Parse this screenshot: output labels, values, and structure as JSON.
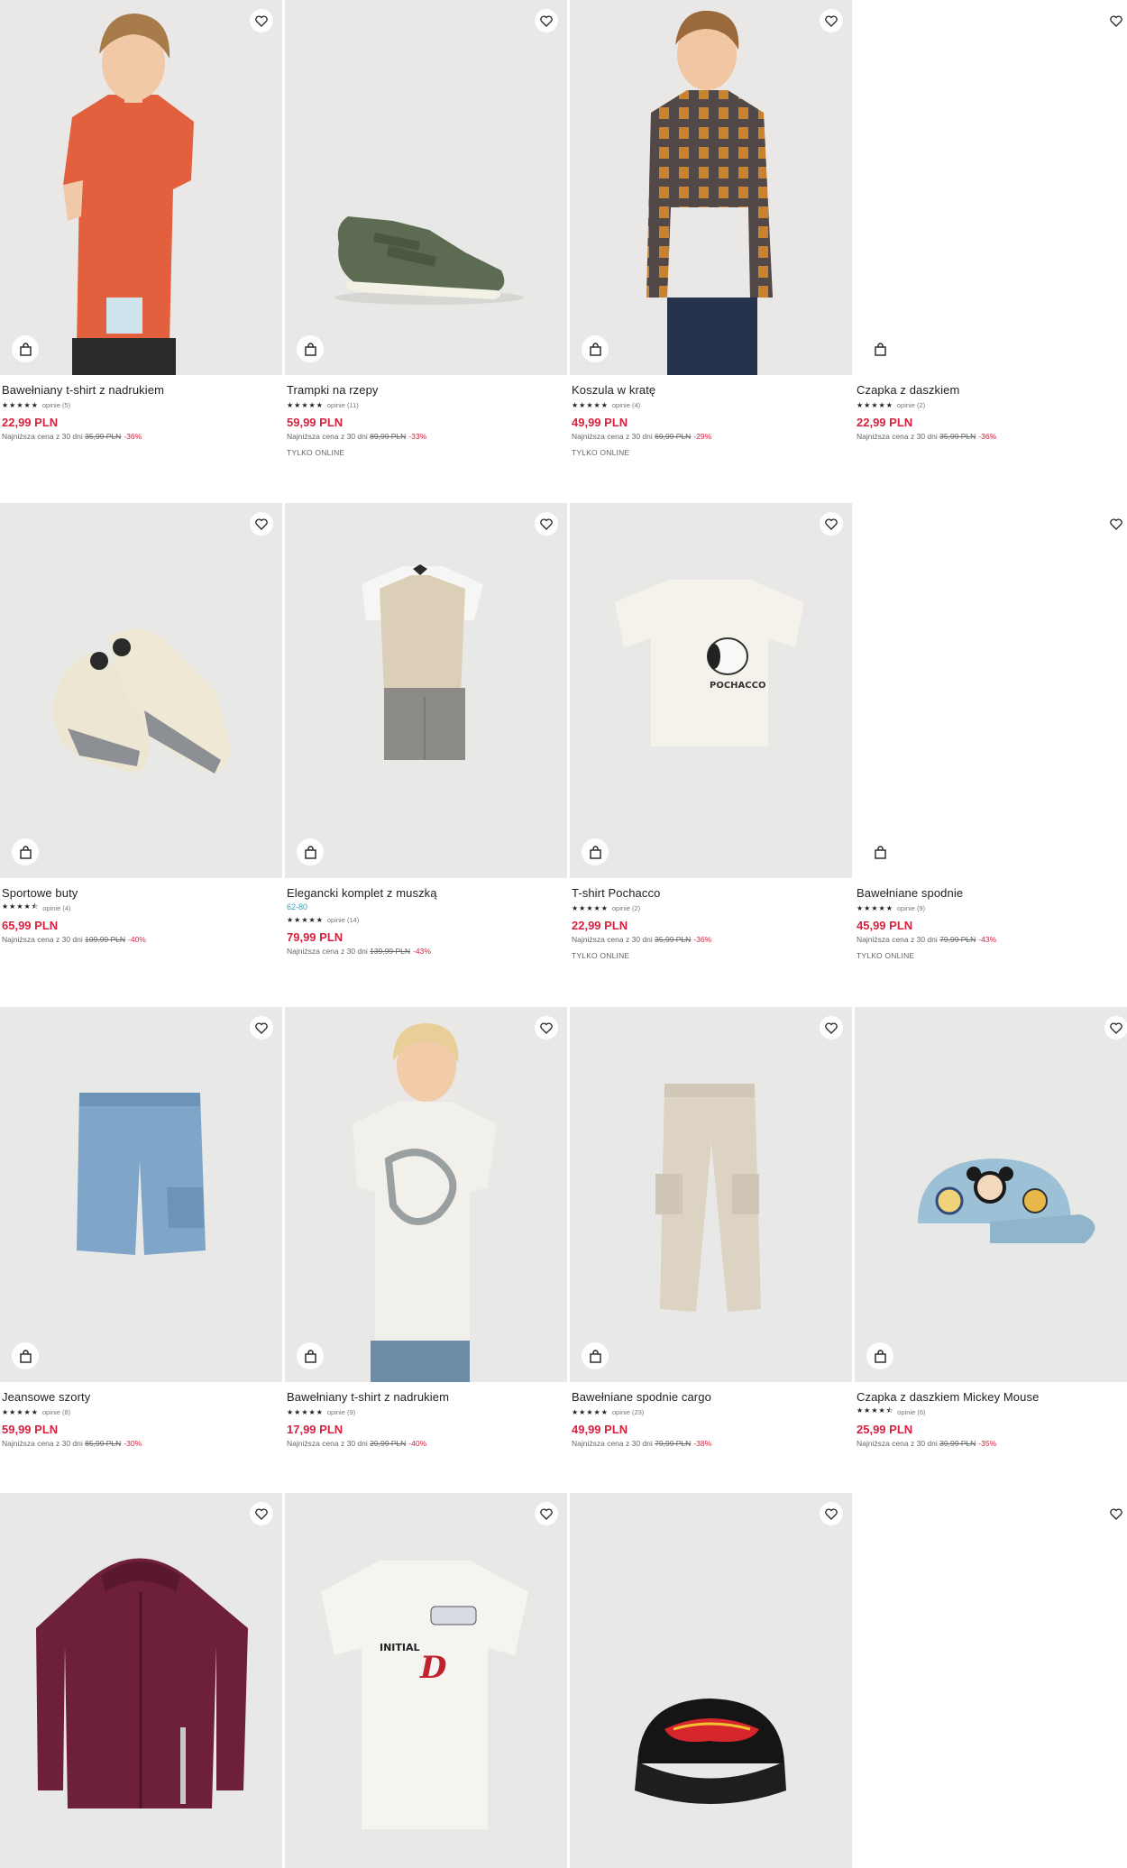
{
  "products": [
    {
      "title": "Bawełniany t-shirt z nadrukiem",
      "size": "",
      "stars": "★★★★★",
      "reviews": "opinie (5)",
      "price": "22,99 PLN",
      "lowest_label": "Najniższa cena z 30 dni",
      "old_price": "35,99 PLN",
      "discount": "-36%",
      "badge": "",
      "image": "boy-orange-tshirt"
    },
    {
      "title": "Trampki na rzepy",
      "size": "",
      "stars": "★★★★★",
      "reviews": "opinie (11)",
      "price": "59,99 PLN",
      "lowest_label": "Najniższa cena z 30 dni",
      "old_price": "89,99 PLN",
      "discount": "-33%",
      "badge": "TYLKO ONLINE",
      "image": "green-velcro-sneaker"
    },
    {
      "title": "Koszula w kratę",
      "size": "",
      "stars": "★★★★★",
      "reviews": "opinie (4)",
      "price": "49,99 PLN",
      "lowest_label": "Najniższa cena z 30 dni",
      "old_price": "69,99 PLN",
      "discount": "-29%",
      "badge": "TYLKO ONLINE",
      "image": "boy-plaid-shirt"
    },
    {
      "title": "Czapka z daszkiem",
      "size": "",
      "stars": "★★★★★",
      "reviews": "opinie (2)",
      "price": "22,99 PLN",
      "lowest_label": "Najniższa cena z 30 dni",
      "old_price": "35,99 PLN",
      "discount": "-36%",
      "badge": "",
      "image": "blank"
    },
    {
      "title": "Sportowe buty",
      "size": "",
      "stars": "★★★★⯪",
      "reviews": "opinie (4)",
      "price": "65,99 PLN",
      "lowest_label": "Najniższa cena z 30 dni",
      "old_price": "109,99 PLN",
      "discount": "-40%",
      "badge": "",
      "image": "sport-sneakers"
    },
    {
      "title": "Elegancki komplet z muszką",
      "size": "62-80",
      "stars": "★★★★★",
      "reviews": "opinie (14)",
      "price": "79,99 PLN",
      "lowest_label": "Najniższa cena z 30 dni",
      "old_price": "139,99 PLN",
      "discount": "-43%",
      "badge": "",
      "image": "vest-set"
    },
    {
      "title": "T-shirt Pochacco",
      "size": "",
      "stars": "★★★★★",
      "reviews": "opinie (2)",
      "price": "22,99 PLN",
      "lowest_label": "Najniższa cena z 30 dni",
      "old_price": "35,99 PLN",
      "discount": "-36%",
      "badge": "TYLKO ONLINE",
      "image": "pochacco-tshirt"
    },
    {
      "title": "Bawełniane spodnie",
      "size": "",
      "stars": "★★★★★",
      "reviews": "opinie (9)",
      "price": "45,99 PLN",
      "lowest_label": "Najniższa cena z 30 dni",
      "old_price": "79,99 PLN",
      "discount": "-43%",
      "badge": "TYLKO ONLINE",
      "image": "blank"
    },
    {
      "title": "Jeansowe szorty",
      "size": "",
      "stars": "★★★★★",
      "reviews": "opinie (8)",
      "price": "59,99 PLN",
      "lowest_label": "Najniższa cena z 30 dni",
      "old_price": "85,99 PLN",
      "discount": "-30%",
      "badge": "",
      "image": "denim-shorts"
    },
    {
      "title": "Bawełniany t-shirt z nadrukiem",
      "size": "",
      "stars": "★★★★★",
      "reviews": "opinie (9)",
      "price": "17,99 PLN",
      "lowest_label": "Najniższa cena z 30 dni",
      "old_price": "29,99 PLN",
      "discount": "-40%",
      "badge": "",
      "image": "boy-graffiti-tshirt"
    },
    {
      "title": "Bawełniane spodnie cargo",
      "size": "",
      "stars": "★★★★★",
      "reviews": "opinie (23)",
      "price": "49,99 PLN",
      "lowest_label": "Najniższa cena z 30 dni",
      "old_price": "79,99 PLN",
      "discount": "-38%",
      "badge": "",
      "image": "cargo-pants"
    },
    {
      "title": "Czapka z daszkiem Mickey Mouse",
      "size": "",
      "stars": "★★★★⯪",
      "reviews": "opinie (6)",
      "price": "25,99 PLN",
      "lowest_label": "Najniższa cena z 30 dni",
      "old_price": "39,99 PLN",
      "discount": "-35%",
      "badge": "",
      "image": "mickey-cap"
    },
    {
      "title": "",
      "size": "",
      "stars": "",
      "reviews": "",
      "price": "",
      "lowest_label": "",
      "old_price": "",
      "discount": "",
      "badge": "",
      "image": "burgundy-hoodie"
    },
    {
      "title": "",
      "size": "",
      "stars": "",
      "reviews": "",
      "price": "",
      "lowest_label": "",
      "old_price": "",
      "discount": "",
      "badge": "",
      "image": "initial-d-tshirt"
    },
    {
      "title": "",
      "size": "",
      "stars": "",
      "reviews": "",
      "price": "",
      "lowest_label": "",
      "old_price": "",
      "discount": "",
      "badge": "",
      "image": "hot-wheels-cap"
    },
    {
      "title": "",
      "size": "",
      "stars": "",
      "reviews": "",
      "price": "",
      "lowest_label": "",
      "old_price": "",
      "discount": "",
      "badge": "",
      "image": "blank"
    }
  ],
  "colors": {
    "price": "#d6223f",
    "size": "#3a9bb4",
    "image_bg": "#e7e7e6"
  },
  "icons": {
    "favorite": "heart-icon",
    "add_to_cart": "shopping-bag-icon"
  }
}
